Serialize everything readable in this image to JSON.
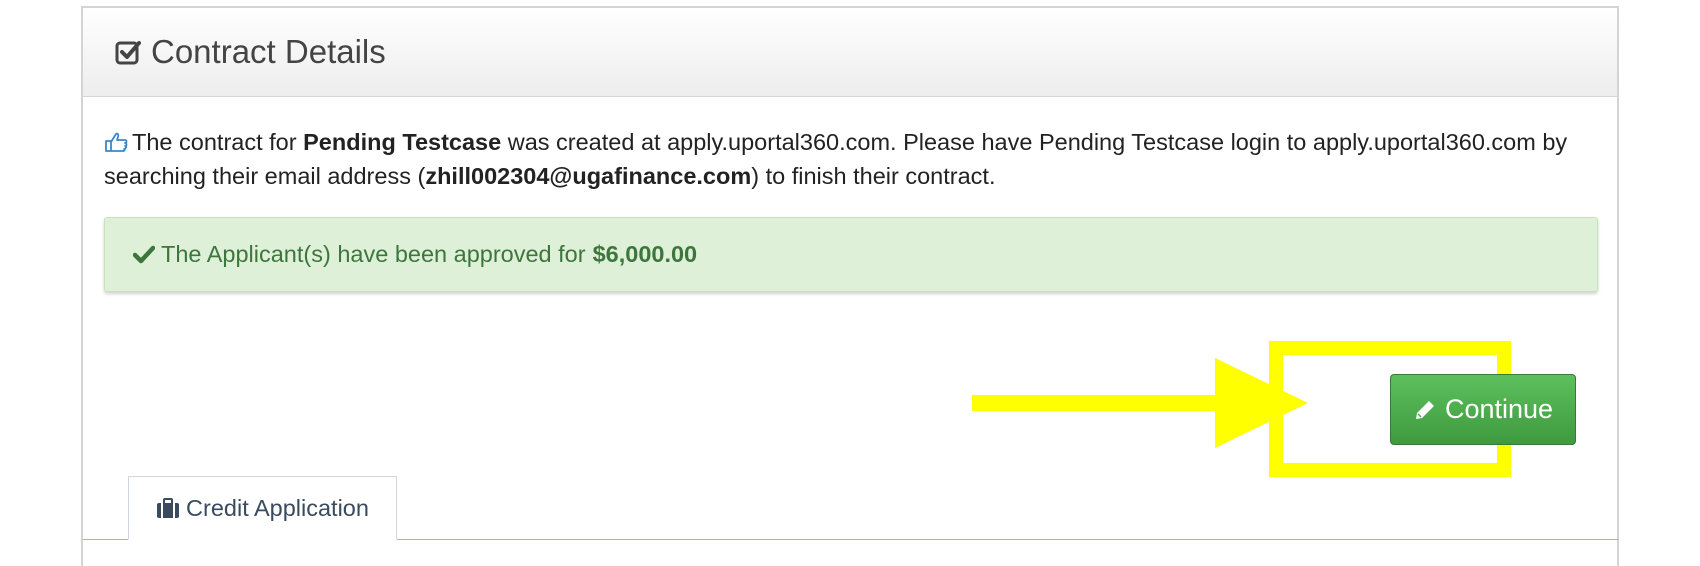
{
  "panel": {
    "title": "Contract Details",
    "title_icon": "check-square-icon"
  },
  "info": {
    "icon": "thumbs-up-icon",
    "part1": "The contract for ",
    "applicant_name": "Pending Testcase",
    "part2": " was created at apply.uportal360.com. Please have Pending Testcase login to apply.uportal360.com by searching their email address (",
    "email": "zhill002304@ugafinance.com",
    "part3": ") to finish their contract."
  },
  "alert": {
    "icon": "check-icon",
    "text": "The Applicant(s) have been approved for",
    "amount": "$6,000.00",
    "color": "#3c763d",
    "background": "#dff0d8"
  },
  "continue_button": {
    "label": "Continue",
    "icon": "pencil-icon",
    "color": "#4cae4c"
  },
  "annotation": {
    "arrow_color": "#ffff00",
    "highlight_color": "#ffff00"
  },
  "tabs": [
    {
      "label": "Credit Application",
      "icon": "briefcase-icon",
      "active": true
    }
  ]
}
